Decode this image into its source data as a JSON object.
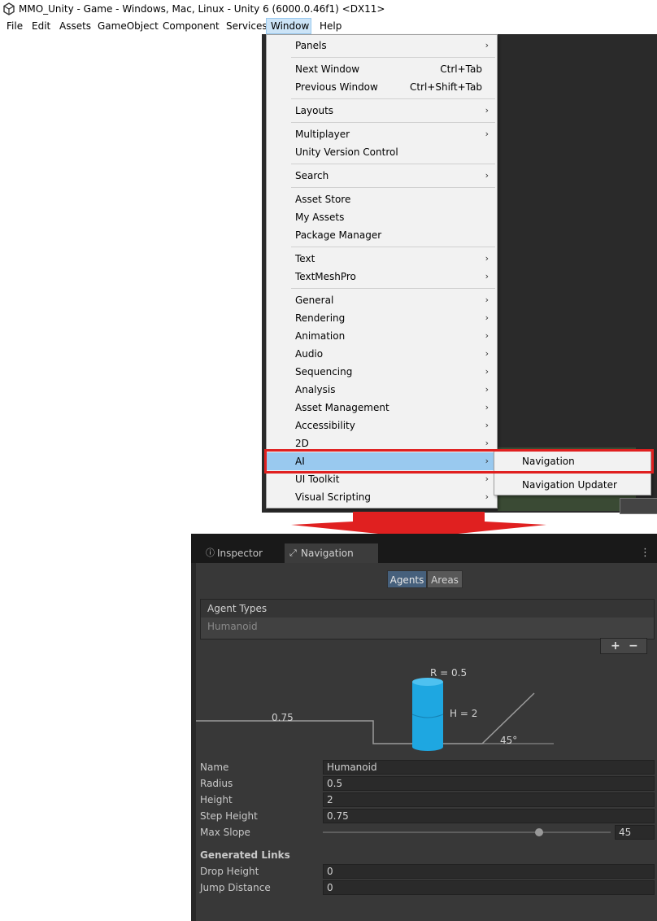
{
  "window": {
    "title": "MMO_Unity - Game - Windows, Mac, Linux - Unity 6 (6000.0.46f1) <DX11>"
  },
  "menubar": {
    "items": [
      "File",
      "Edit",
      "Assets",
      "GameObject",
      "Component",
      "Services",
      "Window",
      "Help"
    ],
    "active": "Window"
  },
  "window_menu": {
    "items": [
      {
        "label": "Panels",
        "submenu": true
      },
      {
        "label": "Next Window",
        "shortcut": "Ctrl+Tab"
      },
      {
        "label": "Previous Window",
        "shortcut": "Ctrl+Shift+Tab"
      },
      {
        "label": "Layouts",
        "submenu": true
      },
      {
        "label": "Multiplayer",
        "submenu": true
      },
      {
        "label": "Unity Version Control"
      },
      {
        "label": "Search",
        "submenu": true
      },
      {
        "label": "Asset Store"
      },
      {
        "label": "My Assets"
      },
      {
        "label": "Package Manager"
      },
      {
        "label": "Text",
        "submenu": true
      },
      {
        "label": "TextMeshPro",
        "submenu": true
      },
      {
        "label": "General",
        "submenu": true
      },
      {
        "label": "Rendering",
        "submenu": true
      },
      {
        "label": "Animation",
        "submenu": true
      },
      {
        "label": "Audio",
        "submenu": true
      },
      {
        "label": "Sequencing",
        "submenu": true
      },
      {
        "label": "Analysis",
        "submenu": true
      },
      {
        "label": "Asset Management",
        "submenu": true
      },
      {
        "label": "Accessibility",
        "submenu": true
      },
      {
        "label": "2D",
        "submenu": true
      },
      {
        "label": "AI",
        "submenu": true,
        "highlighted": true
      },
      {
        "label": "UI Toolkit",
        "submenu": true
      },
      {
        "label": "Visual Scripting",
        "submenu": true
      }
    ]
  },
  "ai_submenu": {
    "items": [
      "Navigation",
      "Navigation Updater"
    ]
  },
  "highlight_color": "#e02020",
  "navigation_panel": {
    "tabs": [
      {
        "label": "Inspector",
        "icon": "info-icon"
      },
      {
        "label": "Navigation",
        "icon": "navigation-icon",
        "active": true
      }
    ],
    "toggle": {
      "agents": "Agents",
      "areas": "Areas",
      "selected": "Agents"
    },
    "agent_types": {
      "header": "Agent Types",
      "rows": [
        "Humanoid"
      ],
      "add": "+",
      "remove": "−"
    },
    "diagram": {
      "radius_label": "R = 0.5",
      "height_label": "H = 2",
      "step_label": "0.75",
      "slope_label": "45°",
      "cylinder_color": "#1ea7e1"
    },
    "fields": {
      "name": {
        "label": "Name",
        "value": "Humanoid"
      },
      "radius": {
        "label": "Radius",
        "value": "0.5"
      },
      "height": {
        "label": "Height",
        "value": "2"
      },
      "step_height": {
        "label": "Step Height",
        "value": "0.75"
      },
      "max_slope": {
        "label": "Max Slope",
        "value": "45",
        "slider_fraction": 0.75
      }
    },
    "generated_links": {
      "title": "Generated Links",
      "drop_height": {
        "label": "Drop Height",
        "value": "0"
      },
      "jump_distance": {
        "label": "Jump Distance",
        "value": "0"
      }
    }
  }
}
